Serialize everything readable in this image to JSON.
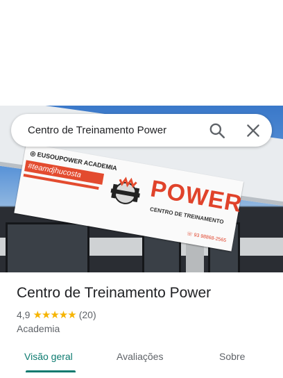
{
  "search": {
    "query": "Centro de Treinamento Power"
  },
  "photo": {
    "banner_instagram": "◎ EUSOUPOWER ACADEMIA",
    "banner_hashtag": "#teamdjhucosta",
    "banner_brand": "POWER",
    "banner_subtitle": "CENTRO DE TREINAMENTO",
    "banner_phone": "☏ 93 98868-2565"
  },
  "place": {
    "title": "Centro de Treinamento Power",
    "rating": "4,9",
    "stars": "★★★★★",
    "review_count": "(20)",
    "category": "Academia"
  },
  "tabs": [
    {
      "label": "Visão geral",
      "active": true
    },
    {
      "label": "Avaliações",
      "active": false
    },
    {
      "label": "Sobre",
      "active": false
    }
  ],
  "colors": {
    "accent": "#0b7a6f",
    "star": "#f6b400",
    "brand_red": "#e0432b"
  }
}
